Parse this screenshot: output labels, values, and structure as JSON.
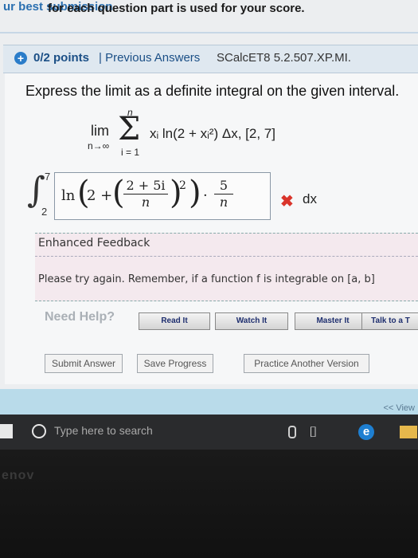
{
  "top_note": {
    "left_fragment": "ur best submission",
    "text": "for each question part is used for your score."
  },
  "question_header": {
    "points": "0/2 points",
    "separator": "|",
    "previous_answers": "Previous Answers",
    "code": "SCalcET8 5.2.507.XP.MI."
  },
  "prompt": "Express the limit as a definite integral on the given interval.",
  "limit_expr": {
    "lim": "lim",
    "lim_sub": "n→∞",
    "sigma": "Σ",
    "sigma_top": "n",
    "sigma_bottom": "i = 1",
    "summand": "xᵢ ln(2 + xᵢ²) Δx, [2, 7]"
  },
  "integral": {
    "sign": "∫",
    "upper": "7",
    "lower": "2",
    "answer": {
      "ln": "ln",
      "two_plus": "2 +",
      "inner_num": "2 + 5i",
      "inner_den": "n",
      "power": "2",
      "dot": "·",
      "outer_num": "5",
      "outer_den": "n"
    },
    "status_icon": "x-mark-icon",
    "status_glyph": "✖",
    "dx": "dx"
  },
  "feedback": {
    "title": "Enhanced Feedback",
    "text": "Please try again. Remember, if a function f is integrable on [a, b]"
  },
  "help": {
    "label": "Need Help?",
    "buttons": [
      "Read It",
      "Watch It",
      "Master It",
      "Talk to a T"
    ]
  },
  "actions": {
    "submit": "Submit Answer",
    "save": "Save Progress",
    "practice": "Practice Another Version"
  },
  "footer": {
    "view": "<< View"
  },
  "taskbar": {
    "search_placeholder": "Type here to search"
  },
  "bezel": {
    "logo": "enov"
  },
  "colors": {
    "accent": "#2a7cc9",
    "error": "#d9342b",
    "footer_band": "#b9dbea",
    "feedback_bg": "#f4e9ee"
  }
}
